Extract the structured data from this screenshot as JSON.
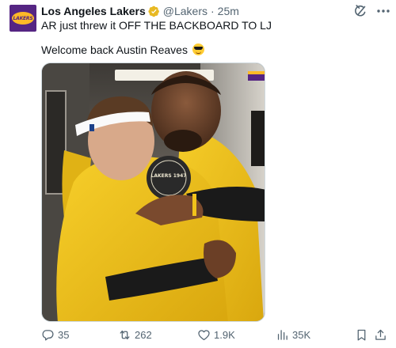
{
  "author": {
    "display_name": "Los Angeles Lakers",
    "handle": "@Lakers",
    "separator": "·",
    "time": "25m",
    "avatar_text": "LAKERS",
    "verified_color": "#e8b923"
  },
  "tweet": {
    "line1": "AR just threw it OFF THE BACKBOARD TO LJ",
    "line2": "Welcome back Austin Reaves",
    "emoji": "smiling-face-with-sunglasses"
  },
  "media": {
    "shirt_text": "LAKERS 1947"
  },
  "actions": {
    "replies": "35",
    "reposts": "262",
    "likes": "1.9K",
    "views": "35K"
  },
  "colors": {
    "brand_purple": "#552583",
    "brand_gold": "#fdb927",
    "text_primary": "#0f1419",
    "text_secondary": "#536471"
  }
}
